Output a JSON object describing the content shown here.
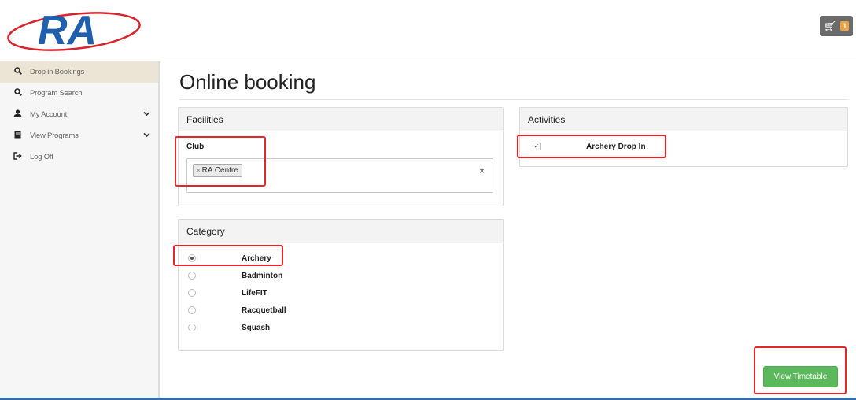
{
  "header": {
    "logo_text": "RA",
    "cart": {
      "icon": "cart-icon",
      "count": "1"
    }
  },
  "sidebar": {
    "items": [
      {
        "label": "Drop in Bookings",
        "icon": "search-icon",
        "active": true
      },
      {
        "label": "Program Search",
        "icon": "search-icon"
      },
      {
        "label": "My Account",
        "icon": "user-icon",
        "expandable": true
      },
      {
        "label": "View Programs",
        "icon": "book-icon",
        "expandable": true
      },
      {
        "label": "Log Off",
        "icon": "logout-icon"
      }
    ]
  },
  "main": {
    "title": "Online booking",
    "facilities": {
      "heading": "Facilities",
      "club_label": "Club",
      "selected_club": "RA Centre",
      "chip_remove": "×",
      "clear": "×"
    },
    "category": {
      "heading": "Category",
      "options": [
        "Archery",
        "Badminton",
        "LifeFIT",
        "Racquetball",
        "Squash"
      ],
      "selected": "Archery"
    },
    "activities": {
      "heading": "Activities",
      "items": [
        {
          "label": "Archery Drop In",
          "checked": true
        }
      ]
    },
    "view_button": "View Timetable"
  },
  "colors": {
    "highlight": "#e8232b",
    "button_green": "#5cb85c",
    "logo_blue": "#1f5fae",
    "logo_red": "#d8232a",
    "accent_bar": "#2f6fb0",
    "active_nav": "#ece4d4"
  }
}
